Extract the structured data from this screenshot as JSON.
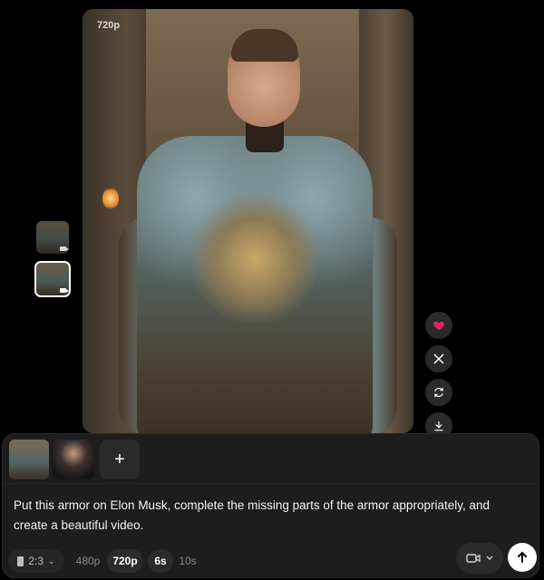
{
  "preview": {
    "resolution_badge": "720p"
  },
  "side_thumbnails": [
    {
      "name": "armor-video-thumb-1",
      "selected": false
    },
    {
      "name": "armor-video-thumb-2",
      "selected": true
    }
  ],
  "actions": {
    "like_icon": "heart-icon",
    "like_color": "#e0245e",
    "share_icon": "x-logo-icon",
    "remix_icon": "refresh-icon",
    "download_icon": "download-icon"
  },
  "composer": {
    "attachments": [
      "armor-image",
      "elon-musk-image"
    ],
    "add_label": "+",
    "prompt": "Put this armor on Elon Musk, complete the missing parts of the armor appropriately, and create a beautiful video.",
    "aspect_ratio": "2:3",
    "resolutions": [
      "480p",
      "720p"
    ],
    "selected_resolution": "720p",
    "durations": [
      "6s",
      "10s"
    ],
    "selected_duration": "6s"
  }
}
